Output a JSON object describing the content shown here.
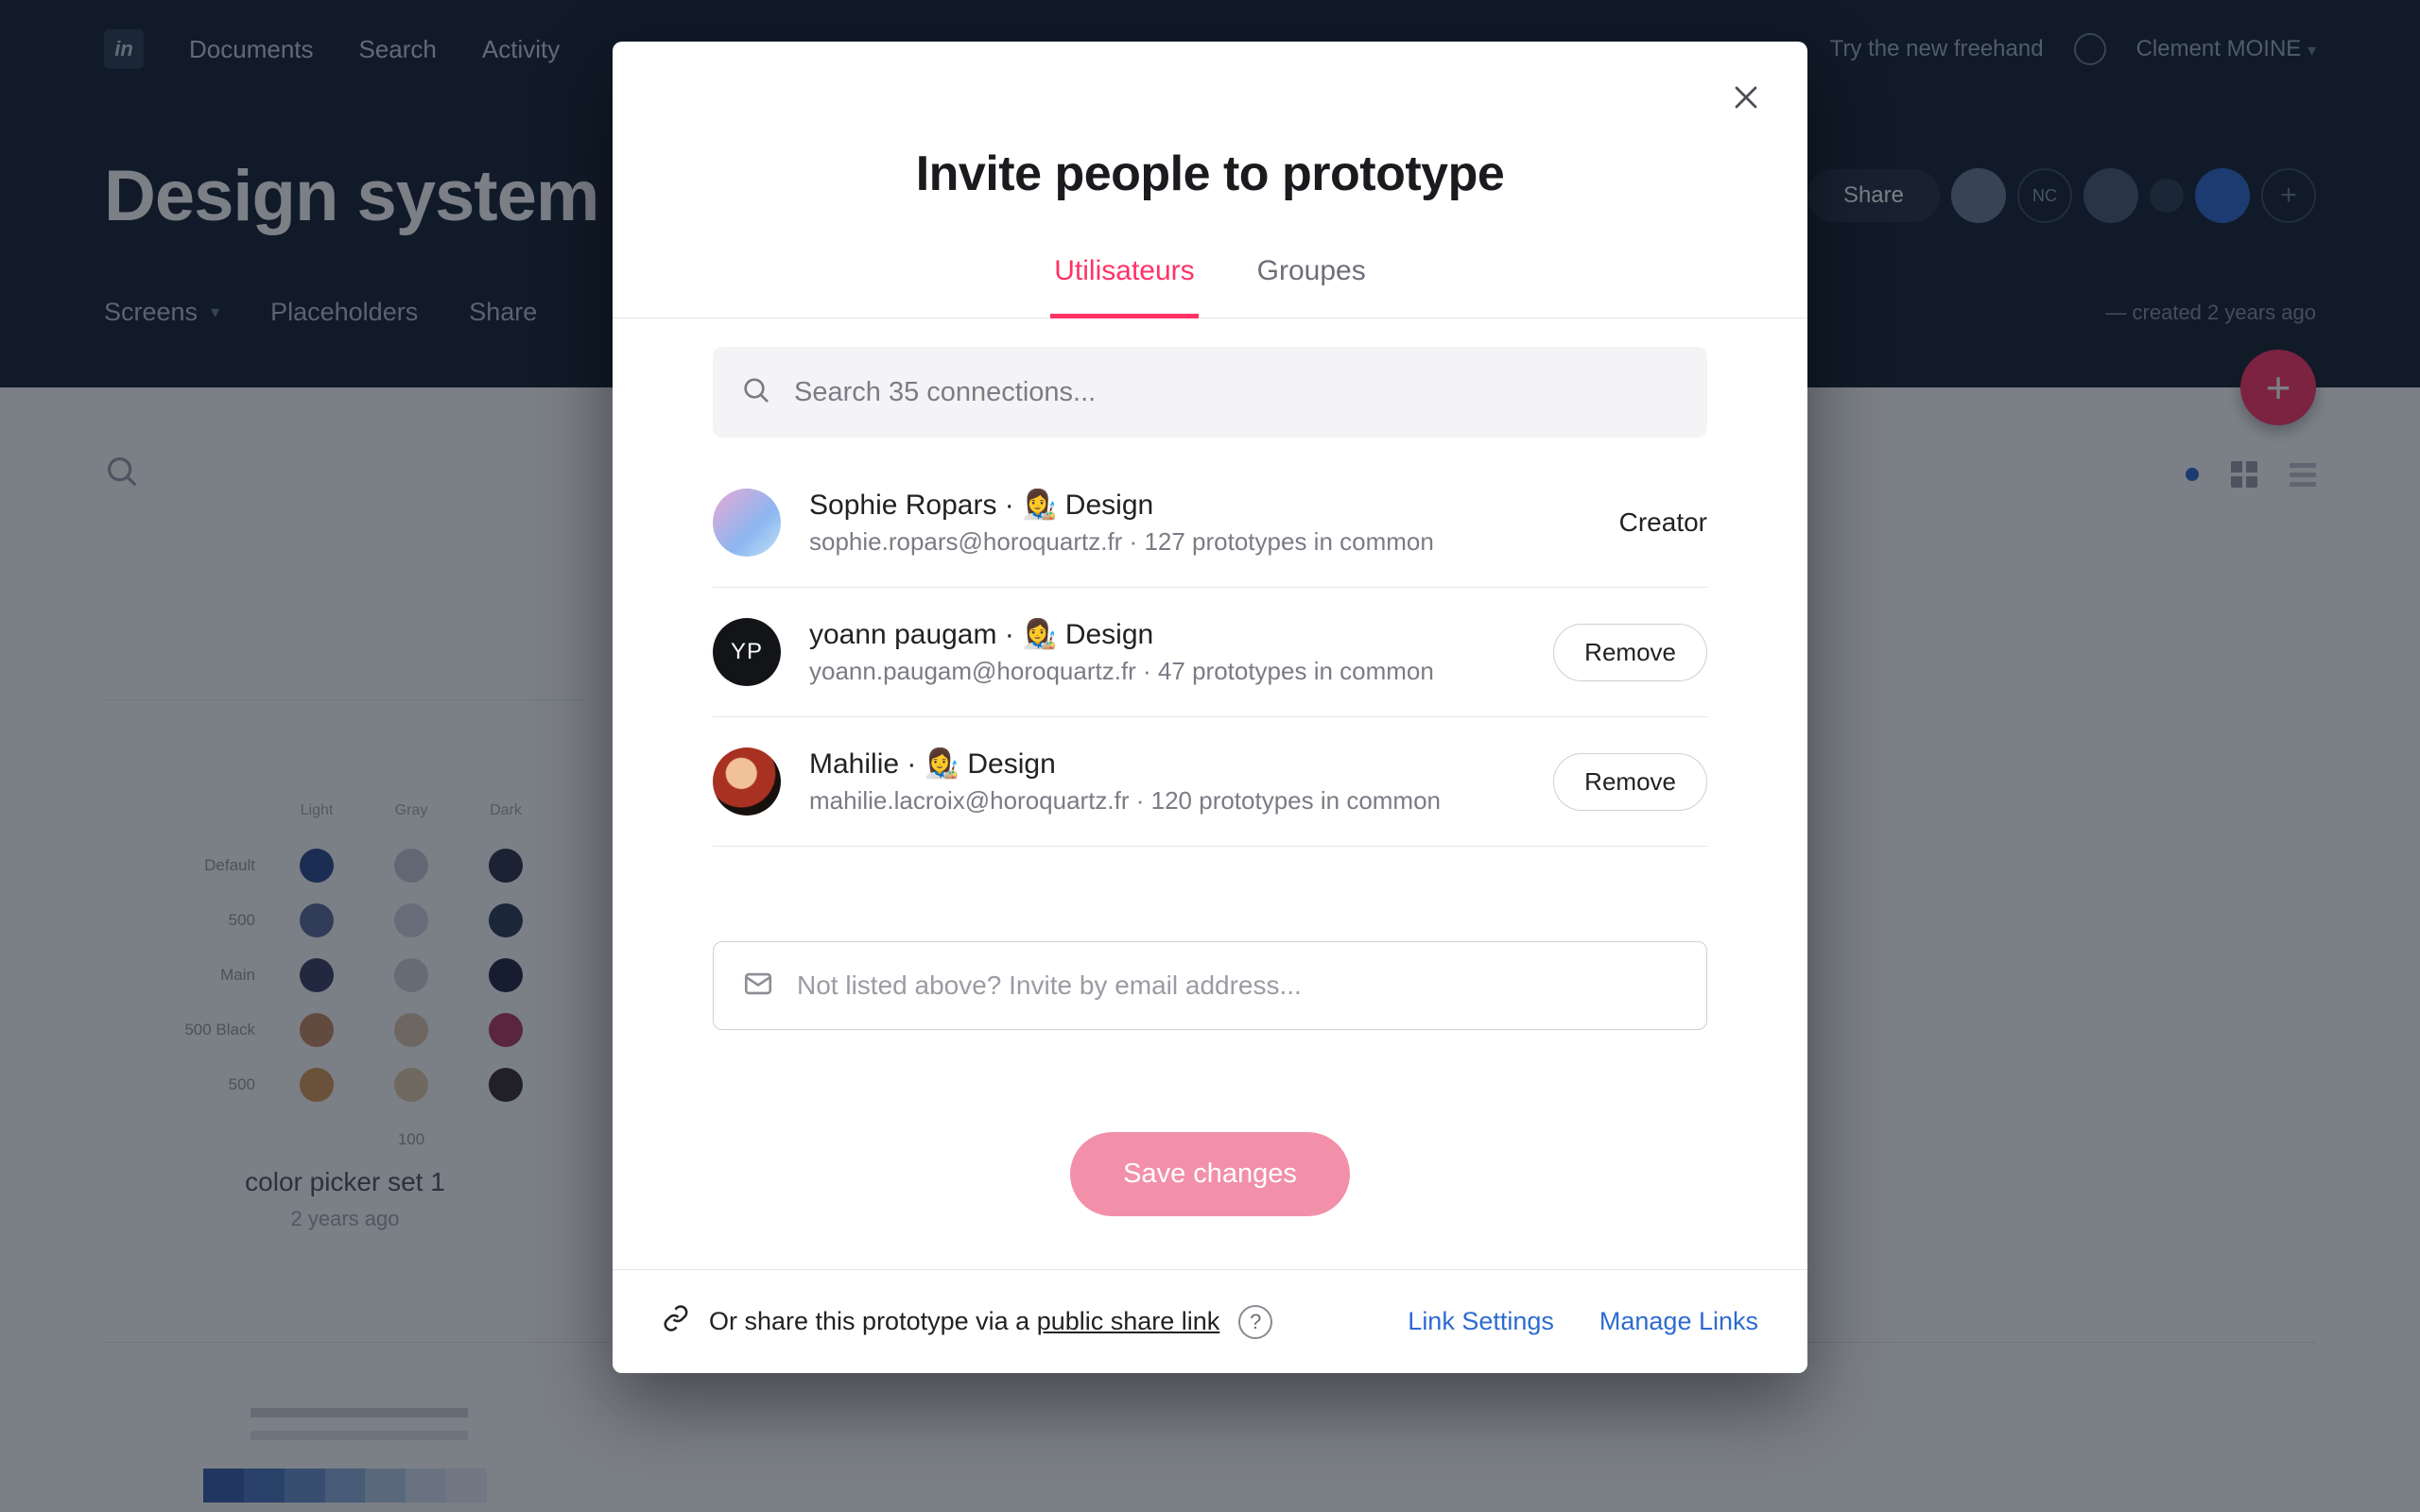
{
  "topnav": {
    "items": [
      "Documents",
      "Search",
      "Activity"
    ],
    "freehand_hint": "Try the new freehand",
    "user": "Clement MOINE"
  },
  "workspace": {
    "title": "Design system",
    "avatars": [
      {
        "initials": "",
        "bg": "#6a7a94"
      },
      {
        "initials": "NC",
        "bg": "transparent"
      },
      {
        "initials": "",
        "bg": "#4a5a74"
      }
    ],
    "share_label": "Share"
  },
  "tabs": {
    "items": [
      "Screens",
      "Placeholders",
      "Share"
    ],
    "meta": "— created 2 years ago"
  },
  "card": {
    "title": "color picker set 1",
    "subtitle": "2 years ago",
    "cols": [
      "",
      "",
      ""
    ],
    "rows": [
      {
        "label": "Default"
      },
      {
        "label": "500"
      },
      {
        "label": "Main"
      },
      {
        "label": "500 Black"
      },
      {
        "label": "500"
      }
    ],
    "last_row": "100"
  },
  "modal": {
    "title": "Invite people to prototype",
    "tabs": {
      "users": "Utilisateurs",
      "groups": "Groupes"
    },
    "search_placeholder": "Search 35 connections...",
    "people": [
      {
        "name": "Sophie Ropars · 👩‍🎨 Design",
        "meta": "sophie.ropars@horoquartz.fr · 127 prototypes in common",
        "role": "Creator",
        "avatar": {
          "type": "image",
          "bg": "linear-gradient(135deg,#d9a0c5,#9ad0f0)"
        }
      },
      {
        "name": "yoann paugam · 👩‍🎨 Design",
        "meta": "yoann.paugam@horoquartz.fr · 47 prototypes in common",
        "role": "Remove",
        "avatar": {
          "type": "initials",
          "initials": "YP",
          "bg": "#111418"
        }
      },
      {
        "name": "Mahilie · 👩‍🎨 Design",
        "meta": "mahilie.lacroix@horoquartz.fr · 120 prototypes in common",
        "role": "Remove",
        "avatar": {
          "type": "image",
          "bg": "radial-gradient(circle at 40% 35%, #f1c6a5 0 28%, #a02a20 30% 60%, #1a1412 62%)"
        }
      }
    ],
    "remove_label": "Remove",
    "creator_label": "Creator",
    "invite_placeholder": "Not listed above? Invite by email address...",
    "save_label": "Save changes",
    "footer": {
      "text_prefix": "Or share this prototype via a",
      "public_link": "public share link",
      "link_settings": "Link Settings",
      "manage_links": "Manage Links"
    }
  }
}
